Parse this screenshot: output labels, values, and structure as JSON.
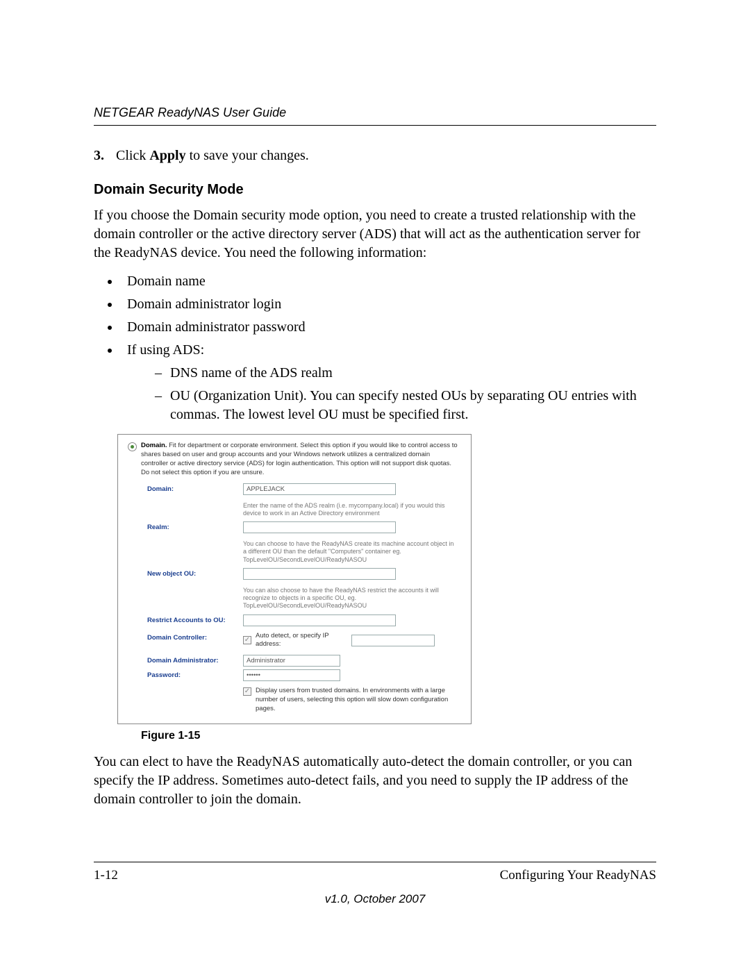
{
  "header": {
    "title": "NETGEAR ReadyNAS User Guide"
  },
  "step": {
    "num": "3.",
    "text_pre": "Click ",
    "text_bold": "Apply",
    "text_post": " to save your changes."
  },
  "section": {
    "title": "Domain Security Mode"
  },
  "intro_para": "If you choose the Domain security mode option, you need to create a trusted relationship with the domain controller or the active directory server (ADS) that will act as the authentication server for the ReadyNAS device. You need the following information:",
  "bullets": {
    "b1": "Domain name",
    "b2": "Domain administrator login",
    "b3": "Domain administrator password",
    "b4": "If using ADS:",
    "b4_sub1": "DNS name of the ADS realm",
    "b4_sub2": "OU (Organization Unit). You can specify nested OUs by separating OU entries with commas. The lowest level OU must be specified first."
  },
  "figure": {
    "radio_bold": "Domain.",
    "radio_text": "Fit for department or corporate environment. Select this option if you would like to control access to shares based on user and group accounts and your Windows network utilizes a centralized domain controller or active directory service (ADS) for login authentication. This option will not support disk quotas. Do not select this option if you are unsure.",
    "domain_label": "Domain:",
    "domain_value": "APPLEJACK",
    "realm_hint": "Enter the name of the ADS realm (i.e. mycompany.local) if you would this device to work in an Active Directory environment",
    "realm_label": "Realm:",
    "newou_hint": "You can choose to have the ReadyNAS create its machine account object in a different OU than the default \"Computers\" container eg. TopLevelOU/SecondLevelOU/ReadyNASOU",
    "newou_label": "New object OU:",
    "restrict_hint": "You can also choose to have the ReadyNAS restrict the accounts it will recognize to objects in a specific OU, eg. TopLevelOU/SecondLevelOU/ReadyNASOU",
    "restrict_label": "Restrict Accounts to OU:",
    "dc_label": "Domain Controller:",
    "dc_text": "Auto detect, or specify IP address:",
    "admin_label": "Domain Administrator:",
    "admin_value": "Administrator",
    "pw_label": "Password:",
    "pw_value": "••••••",
    "display_text": "Display users from trusted domains. In environments with a large number of users, selecting this option will slow down configuration pages."
  },
  "caption": "Figure 1-15",
  "outro_para": "You can elect to have the ReadyNAS automatically auto-detect the domain controller, or you can specify the IP address. Sometimes auto-detect fails, and you need to supply the IP address of the domain controller to join the domain.",
  "footer": {
    "page": "1-12",
    "section": "Configuring Your ReadyNAS",
    "version": "v1.0, October 2007"
  }
}
